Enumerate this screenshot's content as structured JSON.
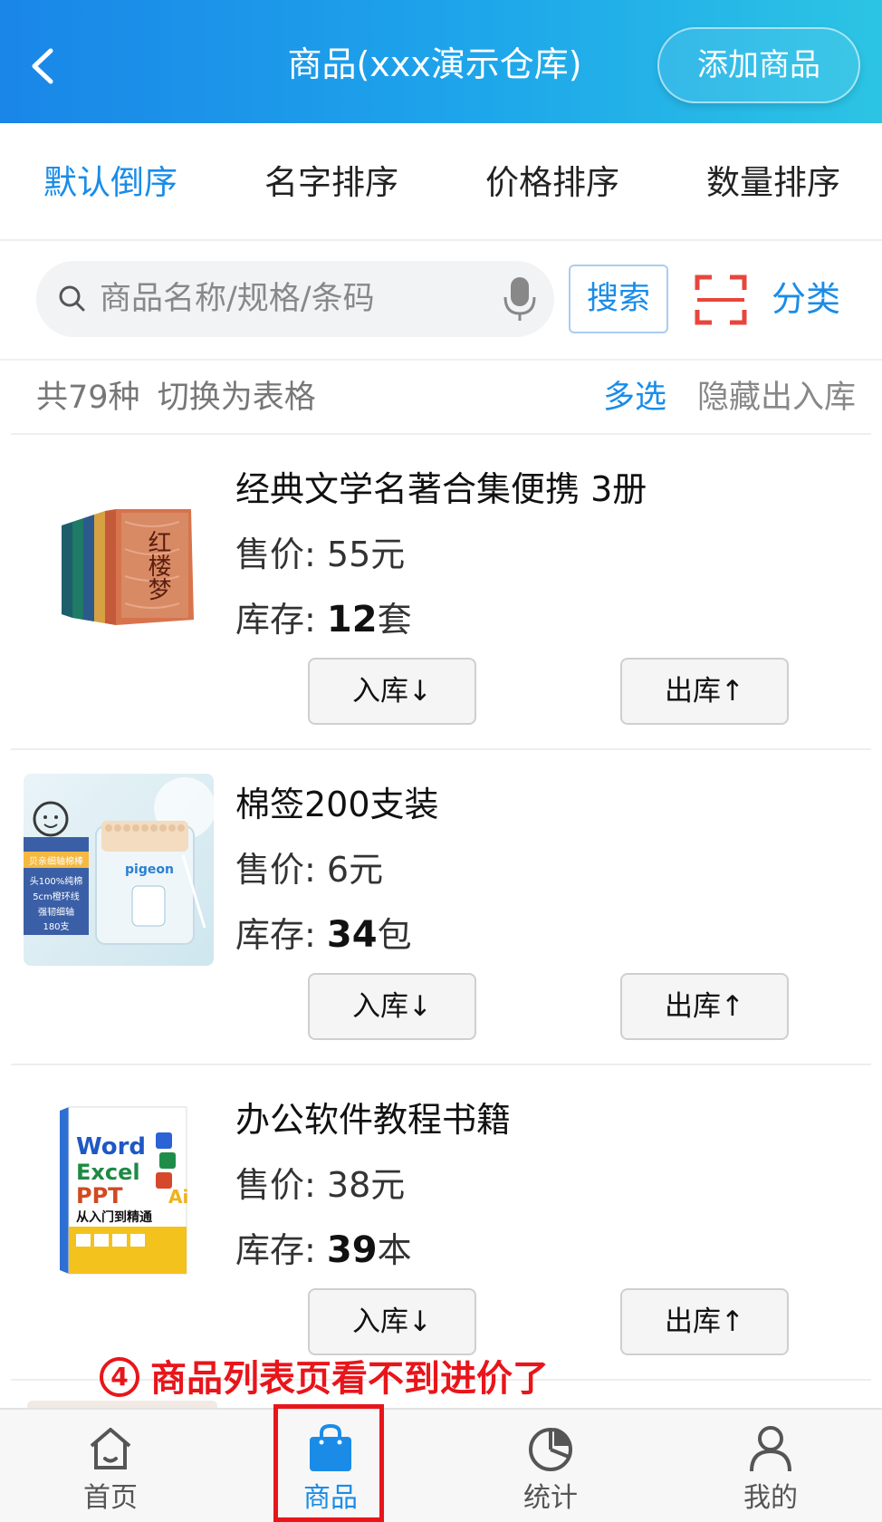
{
  "header": {
    "title": "商品(xxx演示仓库)",
    "add_button": "添加商品"
  },
  "sort_tabs": [
    {
      "label": "默认倒序",
      "active": true
    },
    {
      "label": "名字排序",
      "active": false
    },
    {
      "label": "价格排序",
      "active": false
    },
    {
      "label": "数量排序",
      "active": false
    }
  ],
  "search": {
    "placeholder": "商品名称/规格/条码",
    "button": "搜索",
    "category": "分类"
  },
  "summary": {
    "count_text": "共79种",
    "switch_text": "切换为表格",
    "multi_select": "多选",
    "hide_inout": "隐藏出入库"
  },
  "products": [
    {
      "name": "经典文学名著合集便携  3册",
      "price_label": "售价:",
      "price": "55元",
      "stock_label": "库存:",
      "stock_num": "12",
      "stock_unit": "套",
      "in_label": "入库↓",
      "out_label": "出库↑"
    },
    {
      "name": "棉签200支装",
      "price_label": "售价:",
      "price": "6元",
      "stock_label": "库存:",
      "stock_num": "34",
      "stock_unit": "包",
      "in_label": "入库↓",
      "out_label": "出库↑"
    },
    {
      "name": "办公软件教程书籍",
      "price_label": "售价:",
      "price": "38元",
      "stock_label": "库存:",
      "stock_num": "39",
      "stock_unit": "本",
      "in_label": "入库↓",
      "out_label": "出库↑"
    }
  ],
  "product_images": {
    "book_set_title": "红楼梦",
    "cotton_brand": "pigeon",
    "cotton_lines": [
      "贝亲细轴棉棒",
      "头100%纯棉",
      "5cm橙环线",
      "强韧细轴",
      "180支"
    ],
    "office_book_lines": [
      "Word",
      "Excel",
      "PPT",
      "从入门到精通",
      "Ai"
    ]
  },
  "annotation": {
    "number": "4",
    "text": "商品列表页看不到进价了"
  },
  "bottom_nav": [
    {
      "label": "首页",
      "icon": "home-icon",
      "active": false
    },
    {
      "label": "商品",
      "icon": "bag-icon",
      "active": true
    },
    {
      "label": "统计",
      "icon": "pie-chart-icon",
      "active": false
    },
    {
      "label": "我的",
      "icon": "user-icon",
      "active": false
    }
  ],
  "colors": {
    "accent": "#1a8ce8",
    "annotation": "#e8151b",
    "scan_icon": "#e8453c"
  }
}
